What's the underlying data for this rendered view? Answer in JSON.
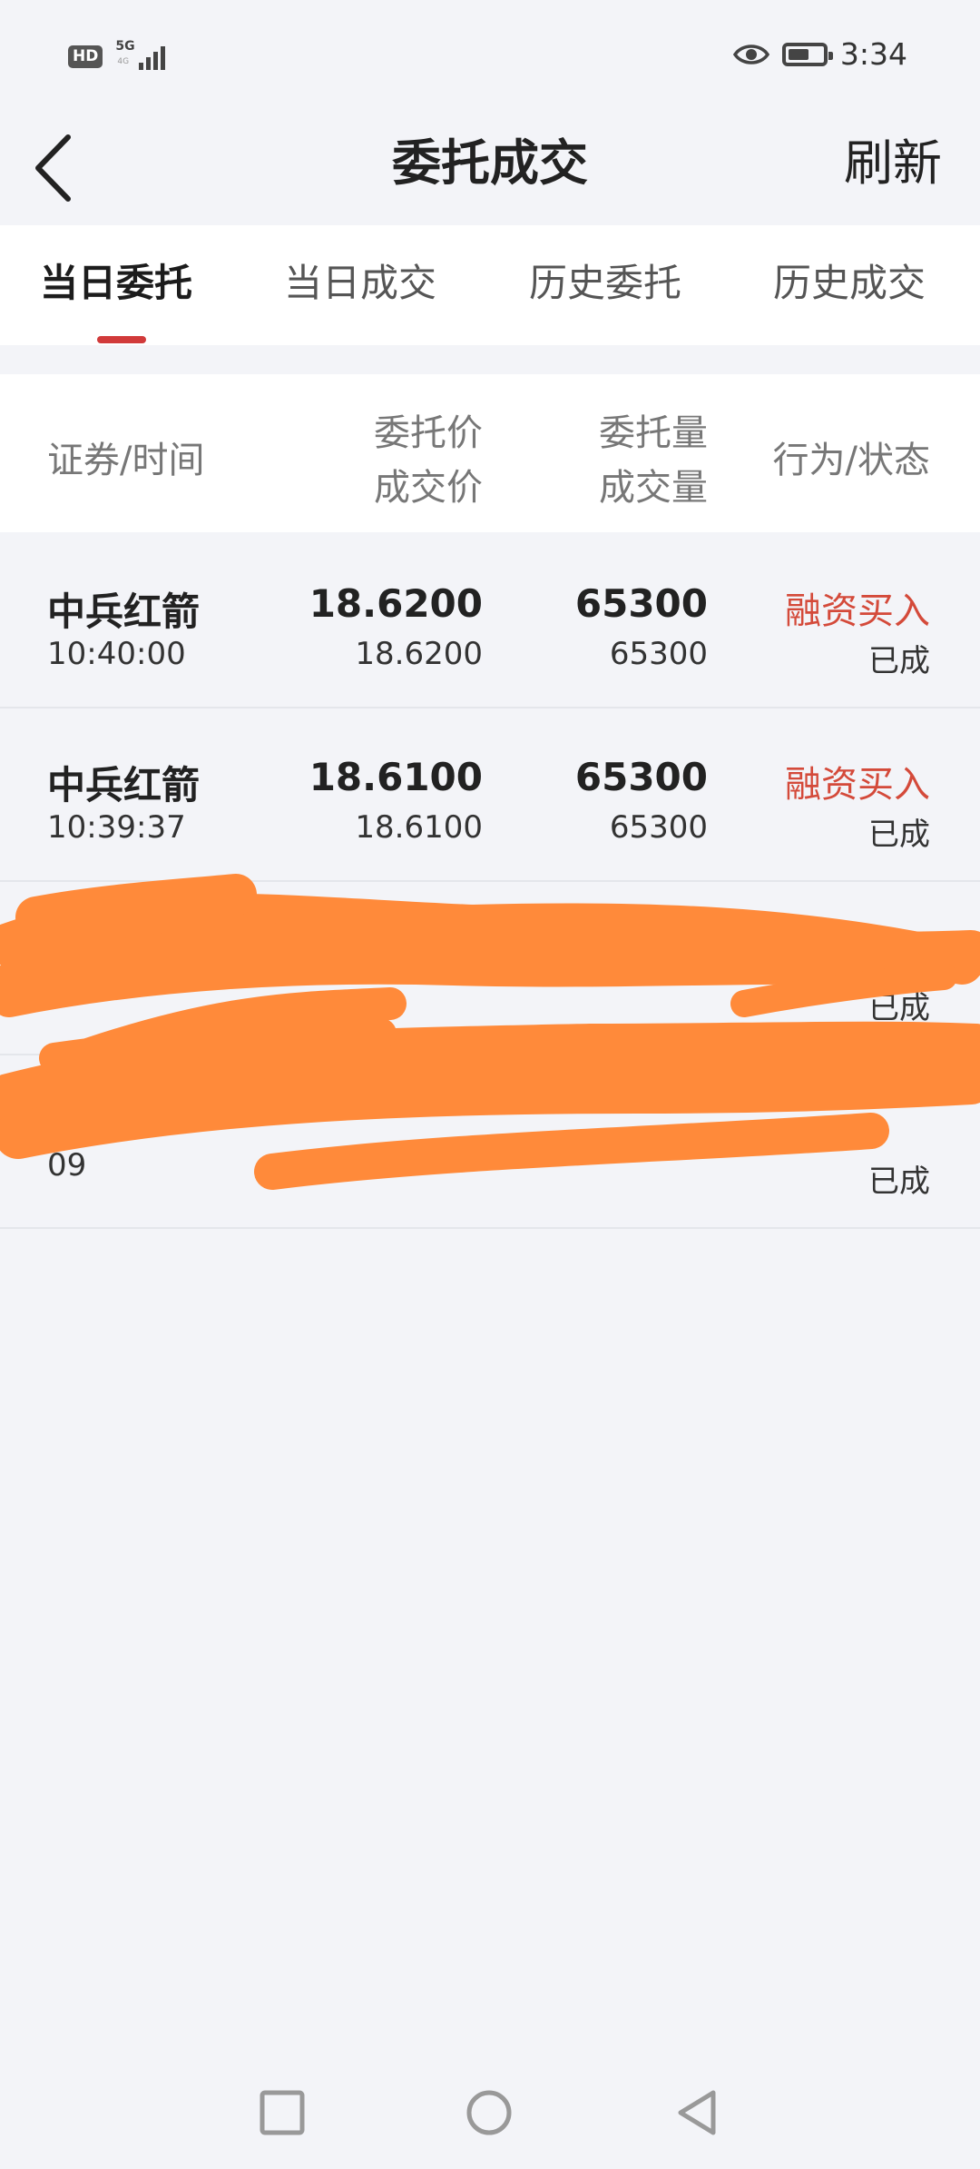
{
  "status_bar": {
    "hd_badge": "HD",
    "network": "5G",
    "network_sub": "4G",
    "time": "3:34",
    "battery_level": 0.6,
    "icons": [
      "eye-icon",
      "battery-icon",
      "signal-icon"
    ]
  },
  "header": {
    "title": "委托成交",
    "refresh_label": "刷新",
    "back_icon": "chevron-left-icon"
  },
  "tabs": [
    {
      "label": "当日委托",
      "active": true
    },
    {
      "label": "当日成交",
      "active": false
    },
    {
      "label": "历史委托",
      "active": false
    },
    {
      "label": "历史成交",
      "active": false
    }
  ],
  "table": {
    "headers": {
      "security_time": "证券/时间",
      "price_line1": "委托价",
      "price_line2": "成交价",
      "qty_line1": "委托量",
      "qty_line2": "成交量",
      "action_status": "行为/状态"
    },
    "rows": [
      {
        "name": "中兵红箭",
        "time": "10:40:00",
        "order_price": "18.6200",
        "deal_price": "18.6200",
        "order_qty": "65300",
        "deal_qty": "65300",
        "action": "融资买入",
        "status": "已成"
      },
      {
        "name": "中兵红箭",
        "time": "10:39:37",
        "order_price": "18.6100",
        "deal_price": "18.6100",
        "order_qty": "65300",
        "deal_qty": "65300",
        "action": "融资买入",
        "status": "已成"
      },
      {
        "name": "",
        "time": "",
        "order_price": "",
        "deal_price": "",
        "order_qty": "",
        "deal_qty": "",
        "action": "",
        "status": "已成"
      },
      {
        "name": "",
        "time": "09",
        "order_price": "",
        "deal_price": "",
        "order_qty": "",
        "deal_qty": "",
        "action": "",
        "status": "已成"
      }
    ]
  },
  "colors": {
    "accent_red": "#d13a3a",
    "action_red": "#d44a3a",
    "redaction_orange": "#ff8a3a",
    "background": "#f3f4f8"
  }
}
